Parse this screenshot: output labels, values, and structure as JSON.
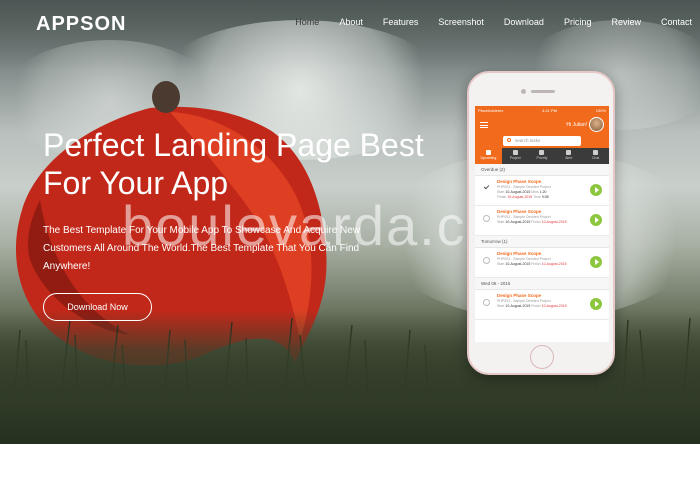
{
  "brand": {
    "logo": "APPSON"
  },
  "nav": {
    "items": [
      {
        "label": "Home",
        "active": true
      },
      {
        "label": "About"
      },
      {
        "label": "Features"
      },
      {
        "label": "Screenshot"
      },
      {
        "label": "Download"
      },
      {
        "label": "Pricing"
      },
      {
        "label": "Review"
      },
      {
        "label": "Contact"
      }
    ]
  },
  "hero": {
    "headline": "Perfect Landing Page Best For Your App",
    "subtext": "The Best Template For Your Mobile App To Showcase And Acquire New Customers All Around The World.The Best Template That You Can Find Anywhere!",
    "cta_label": "Download Now",
    "watermark": "boulevarda.c"
  },
  "phone": {
    "status": {
      "carrier": "Placeholderex",
      "time": "4:21 PM",
      "battery": "100%"
    },
    "greeting": "Hi Julian!",
    "search_placeholder": "search tasks",
    "tabs": [
      "Upcoming",
      "Project",
      "Priority",
      "Alert",
      "Chat"
    ],
    "sections": [
      {
        "title": "Overdue (2)",
        "tasks": [
          {
            "title": "Design Phase Scope",
            "project": "PHP003 - Sample Devided Project",
            "start_label": "Start",
            "start": "10-August-2015",
            "end_label": "Finish",
            "end": "10-August-2015",
            "mins_label": "Mins",
            "mins": "1:20",
            "time_label": "Time",
            "time": "9:08",
            "done": true
          },
          {
            "title": "Design Phase Scope",
            "project": "PHP003 - Sample Devided Project",
            "start_label": "Start",
            "start": "10-August-2015",
            "end_label": "Finish",
            "end": "10-August-2015",
            "done": false
          }
        ]
      },
      {
        "title": "Tomorrow (1)",
        "tasks": [
          {
            "title": "Design Phase Scope",
            "project": "PHP003 - Sample Devided Project",
            "start_label": "Start",
            "start": "10-August-2015",
            "end_label": "Finish",
            "end": "10-August-2015",
            "done": false
          }
        ]
      },
      {
        "title": "Wed 06 - 2015",
        "tasks": [
          {
            "title": "Design Phase Scope",
            "project": "PHP003 - Sample Devided Project",
            "start_label": "Start",
            "start": "10-August-2015",
            "end_label": "Finish",
            "end": "10-August-2015",
            "done": false
          }
        ]
      }
    ]
  },
  "colors": {
    "accent": "#f26b1d",
    "play": "#8dc63f",
    "cape": "#d8301a"
  },
  "icons": [
    "search-icon",
    "menu-icon",
    "play-icon",
    "check-icon"
  ]
}
